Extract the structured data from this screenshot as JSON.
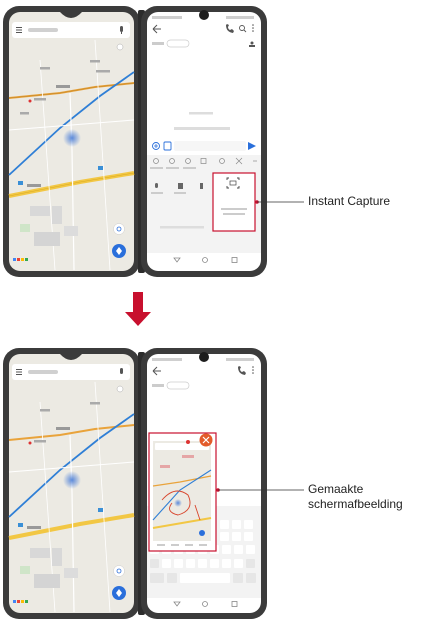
{
  "callouts": {
    "top": "Instant Capture",
    "bottom_line1": "Gemaakte",
    "bottom_line2": "schermafbeelding"
  },
  "arrow": {
    "color": "#c8102e",
    "direction": "down"
  },
  "colors": {
    "accent": "#c8102e",
    "map_background": "#eceae3",
    "map_road_blue": "#2f7fd6",
    "map_road_yellow": "#f2c744",
    "map_road_orange": "#e9a33b",
    "device_frame": "#3b3b3b",
    "keyboard_bg": "#f3f3f3",
    "capture_close": "#e35b2a",
    "fab": "#2a6fdb"
  },
  "icons": [
    "back-arrow-icon",
    "call-icon",
    "search-icon",
    "more-vert-icon",
    "send-icon",
    "mic-icon",
    "close-icon",
    "location-icon",
    "my-location-icon",
    "capture-icon"
  ]
}
